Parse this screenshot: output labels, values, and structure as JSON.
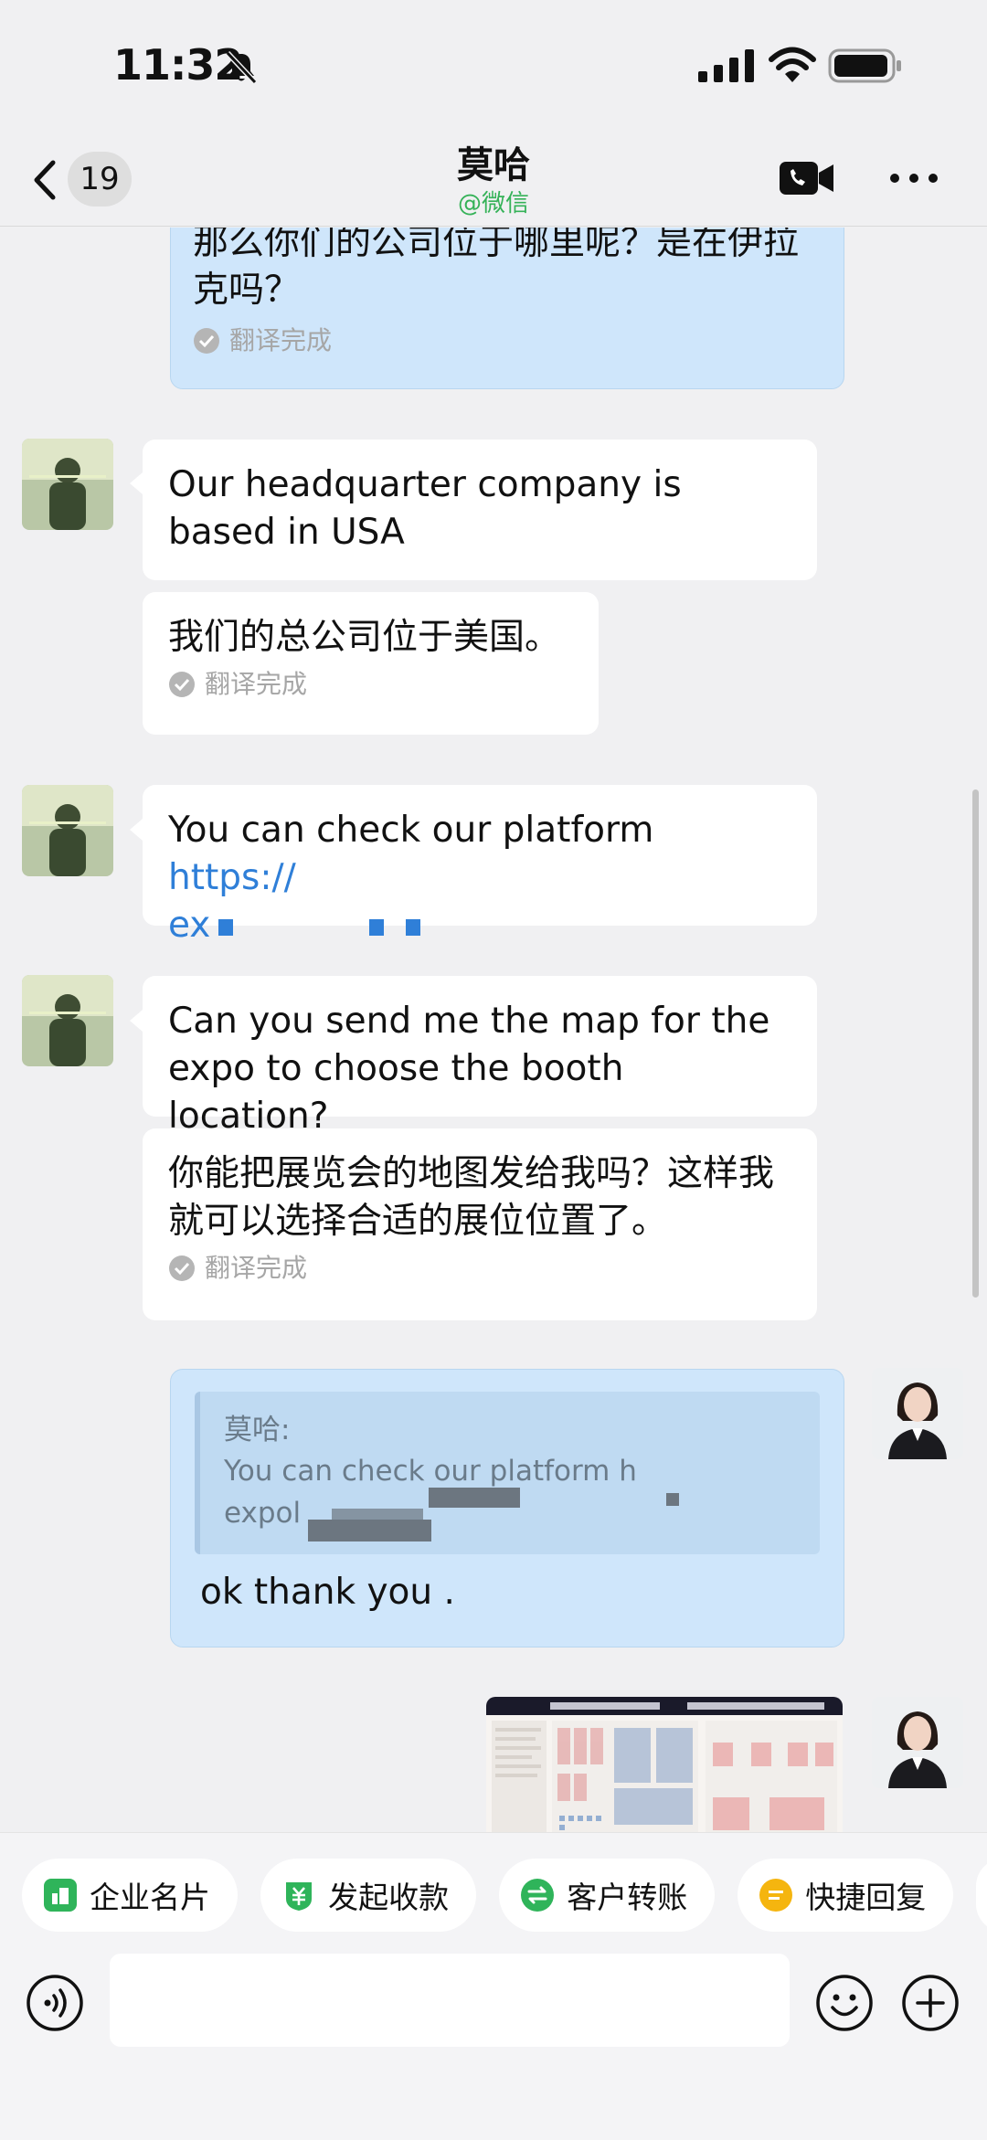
{
  "status_bar": {
    "time": "11:32"
  },
  "header": {
    "unread_count": "19",
    "contact_name": "莫哈",
    "contact_source": "@微信"
  },
  "messages": {
    "m1": {
      "text": "那么你们的公司位于哪里呢？是在伊拉克吗？",
      "status": "翻译完成"
    },
    "m2": {
      "text": "Our headquarter company is based in USA"
    },
    "m3": {
      "text": "我们的总公司位于美国。",
      "status": "翻译完成"
    },
    "m4": {
      "text": "You can check our platform ",
      "link": "https://",
      "link_line2": "ex"
    },
    "m5": {
      "text": "Can you send me the map for the expo to choose the booth location?"
    },
    "m6": {
      "text": "你能把展览会的地图发给我吗？这样我就可以选择合适的展位位置了。",
      "status": "翻译完成"
    },
    "m7": {
      "quote_name": "莫哈:",
      "quote_line1": "You can check our platform h",
      "quote_line2": "expol",
      "text": "ok thank you ."
    }
  },
  "quick_actions": [
    {
      "label": "企业名片",
      "icon": "business-card-icon"
    },
    {
      "label": "发起收款",
      "icon": "collect-payment-icon"
    },
    {
      "label": "客户转账",
      "icon": "transfer-icon"
    },
    {
      "label": "快捷回复",
      "icon": "quick-reply-icon"
    }
  ],
  "colors": {
    "outgoing_bubble": "#cfe6fb",
    "link": "#2f7fd8",
    "source_green": "#35b258",
    "background": "#f0f0f2"
  }
}
